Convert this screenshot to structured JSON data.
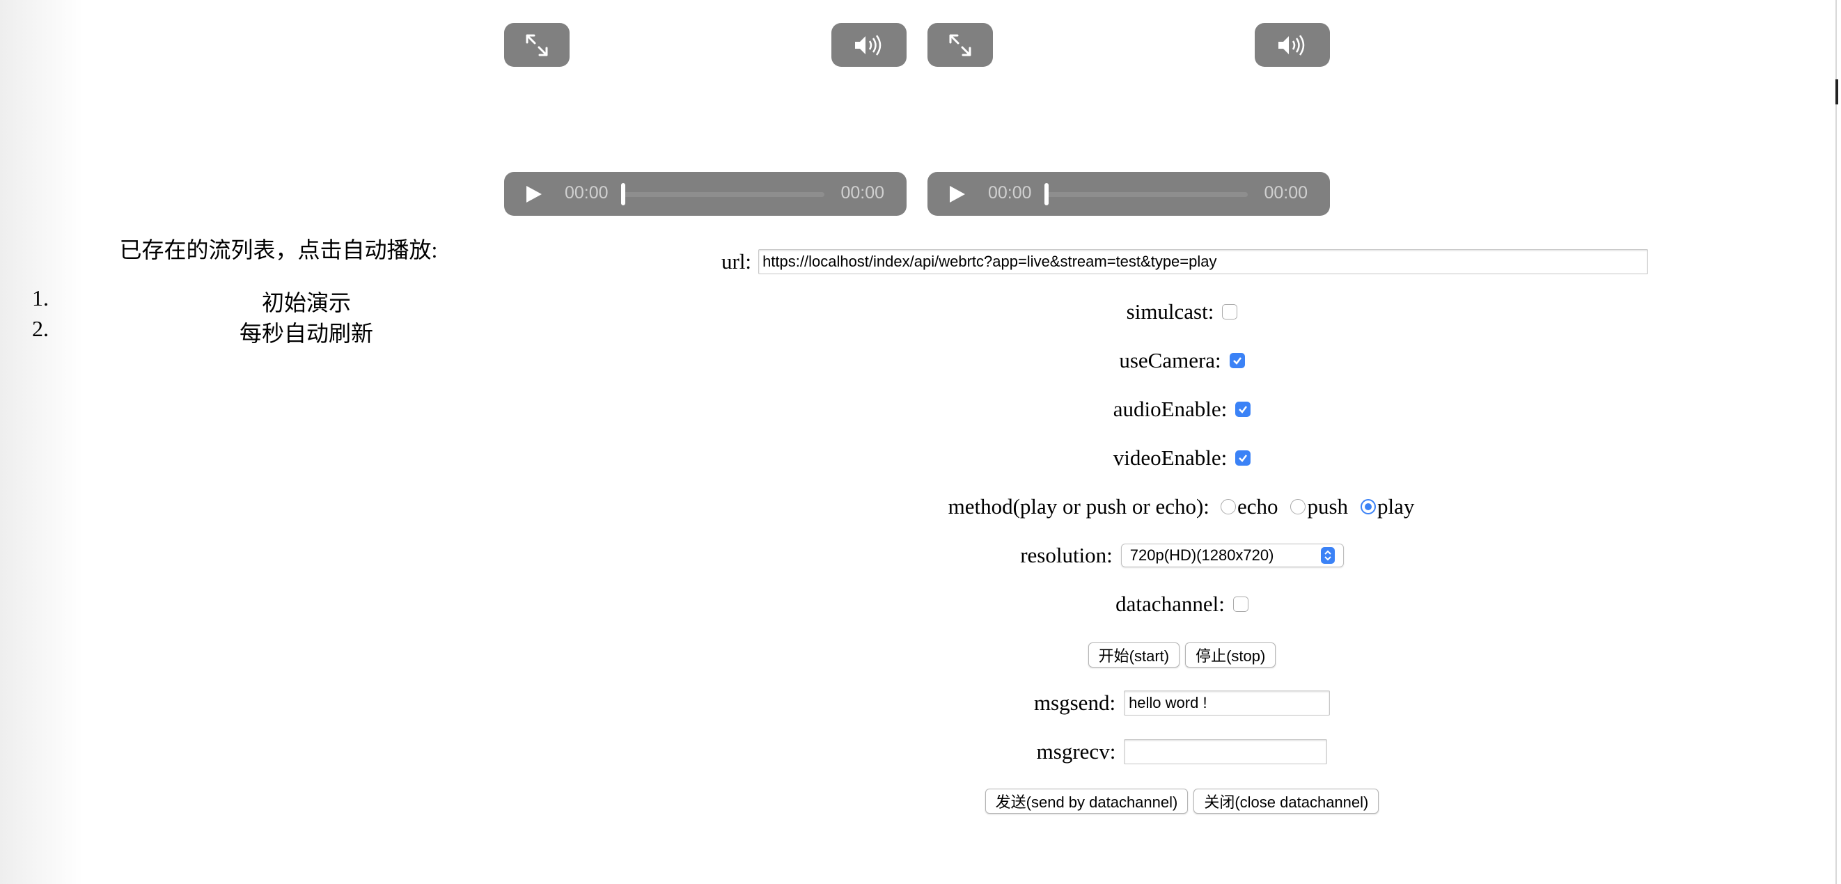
{
  "players": [
    {
      "current_time": "00:00",
      "duration": "00:00"
    },
    {
      "current_time": "00:00",
      "duration": "00:00"
    }
  ],
  "stream_list": {
    "title": "已存在的流列表，点击自动播放:",
    "items": [
      {
        "num": "1.",
        "label": "初始演示"
      },
      {
        "num": "2.",
        "label": "每秒自动刷新"
      }
    ]
  },
  "form": {
    "url_label": "url:",
    "url_value": "https://localhost/index/api/webrtc?app=live&stream=test&type=play",
    "simulcast_label": "simulcast:",
    "simulcast_checked": false,
    "usecamera_label": "useCamera:",
    "usecamera_checked": true,
    "audio_label": "audioEnable:",
    "audio_checked": true,
    "video_label": "videoEnable:",
    "video_checked": true,
    "method_label": "method(play or push or echo):",
    "method_options": [
      "echo",
      "push",
      "play"
    ],
    "method_selected": "play",
    "resolution_label": "resolution:",
    "resolution_value": "720p(HD)(1280x720)",
    "datachannel_label": "datachannel:",
    "datachannel_checked": false,
    "start_label": "开始(start)",
    "stop_label": "停止(stop)",
    "msgsend_label": "msgsend:",
    "msgsend_value": "hello word !",
    "msgrecv_label": "msgrecv:",
    "msgrecv_value": "",
    "send_label": "发送(send by datachannel)",
    "close_label": "关闭(close datachannel)"
  },
  "colors": {
    "accent": "#3b82f6",
    "player_controls": "#808080"
  }
}
